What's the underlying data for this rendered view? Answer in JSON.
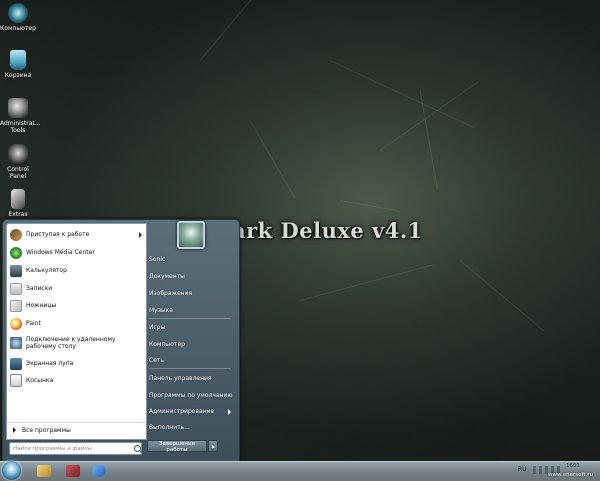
{
  "desktop": {
    "icons": [
      {
        "label": "Компьютер",
        "icon": "computer-icon"
      },
      {
        "label": "Корзина",
        "icon": "recycle-bin-icon"
      },
      {
        "label": "Administrat... Tools",
        "icon": "admin-tools-icon"
      },
      {
        "label": "Control Panel",
        "icon": "control-panel-icon"
      },
      {
        "label": "Extras",
        "icon": "extras-icon"
      }
    ],
    "wallpaper_text": "ark Deluxe v4.1"
  },
  "start_menu": {
    "left_items": [
      {
        "label": "Приступая к работе",
        "icon": "getting-started-icon",
        "has_submenu": true
      },
      {
        "label": "Windows Media Center",
        "icon": "media-center-icon",
        "has_submenu": false
      },
      {
        "label": "Калькулятор",
        "icon": "calculator-icon",
        "has_submenu": false
      },
      {
        "label": "Записки",
        "icon": "sticky-notes-icon",
        "has_submenu": false
      },
      {
        "label": "Ножницы",
        "icon": "snipping-tool-icon",
        "has_submenu": false
      },
      {
        "label": "Paint",
        "icon": "paint-icon",
        "has_submenu": false
      },
      {
        "label": "Подключение к удаленному рабочему столу",
        "icon": "remote-desktop-icon",
        "has_submenu": false
      },
      {
        "label": "Экранная лупа",
        "icon": "magnifier-icon",
        "has_submenu": false
      },
      {
        "label": "Косынка",
        "icon": "solitaire-icon",
        "has_submenu": false
      }
    ],
    "all_programs": "Все программы",
    "search_placeholder": "Найти программы и файлы",
    "user_name": "Sonic",
    "right_items": [
      {
        "label": "Документы",
        "has_submenu": false
      },
      {
        "label": "Изображения",
        "has_submenu": false
      },
      {
        "label": "Музыка",
        "has_submenu": false
      },
      {
        "label": "Игры",
        "has_submenu": false
      },
      {
        "label": "Компьютер",
        "has_submenu": false
      },
      {
        "label": "Сеть",
        "has_submenu": false
      },
      {
        "label": "Панель управления",
        "has_submenu": false
      },
      {
        "label": "Программы по умолчанию",
        "has_submenu": false
      },
      {
        "label": "Администрирование",
        "has_submenu": true
      },
      {
        "label": "Выполнить...",
        "has_submenu": false
      }
    ],
    "shutdown_label": "Завершение работы"
  },
  "taskbar": {
    "language": "RU",
    "clock": "1601",
    "watermark": "www.enersoft.ru"
  }
}
